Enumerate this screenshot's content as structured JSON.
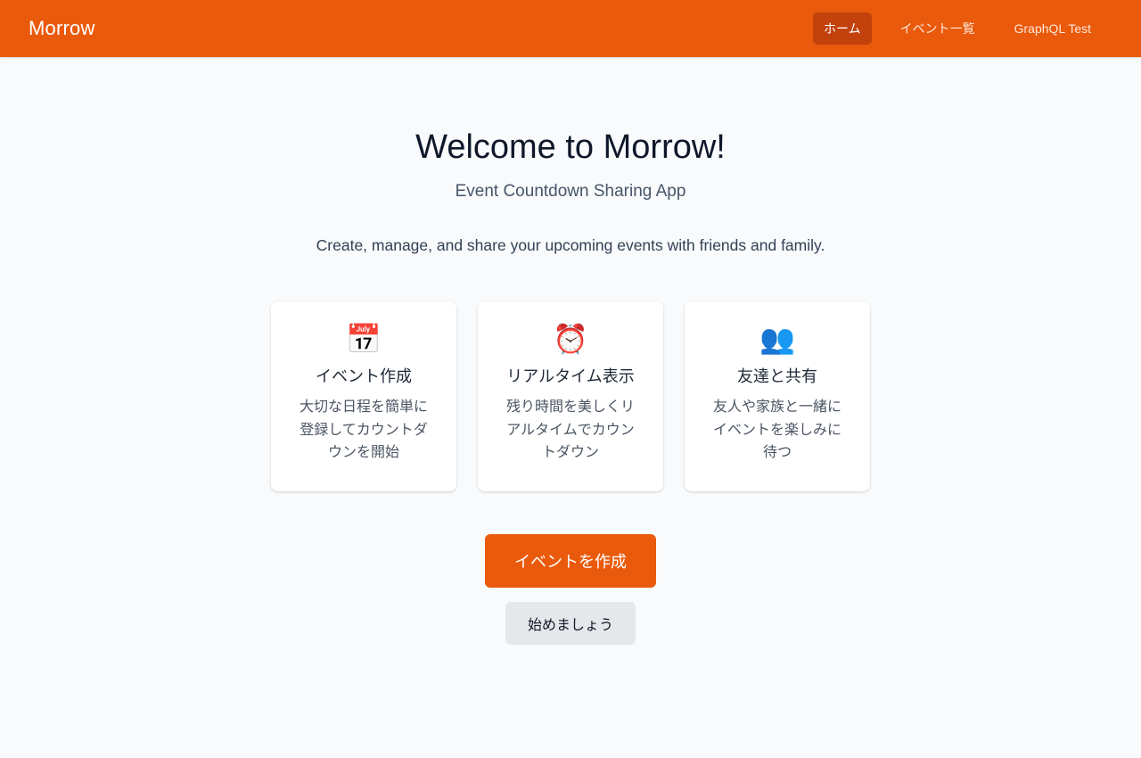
{
  "header": {
    "brand": "Morrow",
    "nav": [
      {
        "label": "ホーム",
        "active": true
      },
      {
        "label": "イベント一覧",
        "active": false
      },
      {
        "label": "GraphQL Test",
        "active": false
      }
    ]
  },
  "hero": {
    "title": "Welcome to Morrow!",
    "subtitle": "Event Countdown Sharing App",
    "description": "Create, manage, and share your upcoming events with friends and family."
  },
  "features": [
    {
      "icon": "📅",
      "icon_name": "calendar-icon",
      "title": "イベント作成",
      "text": "大切な日程を簡単に登録してカウントダウンを開始"
    },
    {
      "icon": "⏰",
      "icon_name": "alarm-clock-icon",
      "title": "リアルタイム表示",
      "text": "残り時間を美しくリアルタイムでカウントダウン"
    },
    {
      "icon": "👥",
      "icon_name": "people-icon",
      "title": "友達と共有",
      "text": "友人や家族と一緒にイベントを楽しみに待つ"
    }
  ],
  "actions": {
    "primary_label": "イベントを作成",
    "secondary_label": "始めましょう"
  },
  "colors": {
    "accent": "#ea5a0c",
    "nav_active": "#c2410c",
    "background": "#f8fafc"
  }
}
